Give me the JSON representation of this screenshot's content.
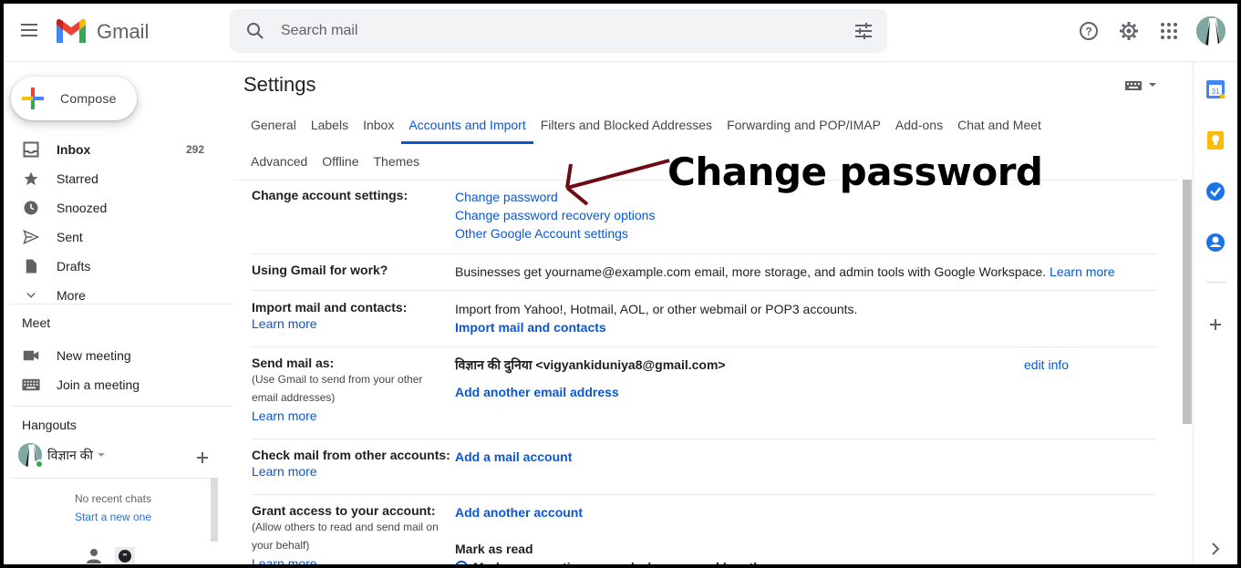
{
  "header": {
    "app_name": "Gmail",
    "search_placeholder": "Search mail"
  },
  "compose": {
    "label": "Compose"
  },
  "nav": {
    "items": [
      {
        "label": "Inbox",
        "count": "292"
      },
      {
        "label": "Starred"
      },
      {
        "label": "Snoozed"
      },
      {
        "label": "Sent"
      },
      {
        "label": "Drafts"
      },
      {
        "label": "More"
      }
    ]
  },
  "meet": {
    "title": "Meet",
    "new_meeting": "New meeting",
    "join_meeting": "Join a meeting"
  },
  "hangouts": {
    "title": "Hangouts",
    "user_name": "विज्ञान की",
    "no_recent": "No recent chats",
    "start_new": "Start a new one"
  },
  "settings": {
    "title": "Settings",
    "tabs_row1": [
      "General",
      "Labels",
      "Inbox",
      "Accounts and Import",
      "Filters and Blocked Addresses",
      "Forwarding and POP/IMAP",
      "Add-ons",
      "Chat and Meet"
    ],
    "tabs_row2": [
      "Advanced",
      "Offline",
      "Themes"
    ],
    "active_tab": "Accounts and Import",
    "change_account": {
      "label": "Change account settings:",
      "links": [
        "Change password",
        "Change password recovery options",
        "Other Google Account settings"
      ]
    },
    "gmail_work": {
      "label": "Using Gmail for work?",
      "text": "Businesses get yourname@example.com email, more storage, and admin tools with Google Workspace.",
      "learn_more": "Learn more"
    },
    "import_mail": {
      "label": "Import mail and contacts:",
      "learn_more": "Learn more",
      "text": "Import from Yahoo!, Hotmail, AOL, or other webmail or POP3 accounts.",
      "action": "Import mail and contacts"
    },
    "send_as": {
      "label": "Send mail as:",
      "sub": "(Use Gmail to send from your other email addresses)",
      "learn_more": "Learn more",
      "identity": "विज्ञान की दुनिया <vigyankiduniya8@gmail.com>",
      "edit": "edit info",
      "add": "Add another email address"
    },
    "check_mail": {
      "label": "Check mail from other accounts:",
      "learn_more": "Learn more",
      "action": "Add a mail account"
    },
    "grant_access": {
      "label": "Grant access to your account:",
      "sub": "(Allow others to read and send mail on your behalf)",
      "learn_more": "Learn more",
      "action": "Add another account",
      "mark_read_title": "Mark as read",
      "mark_read_option": "Mark conversation as read when opened by others"
    }
  },
  "annotation": {
    "text": "Change password"
  },
  "colors": {
    "link": "#0b57d0",
    "annotation_arrow": "#6d0a14"
  }
}
